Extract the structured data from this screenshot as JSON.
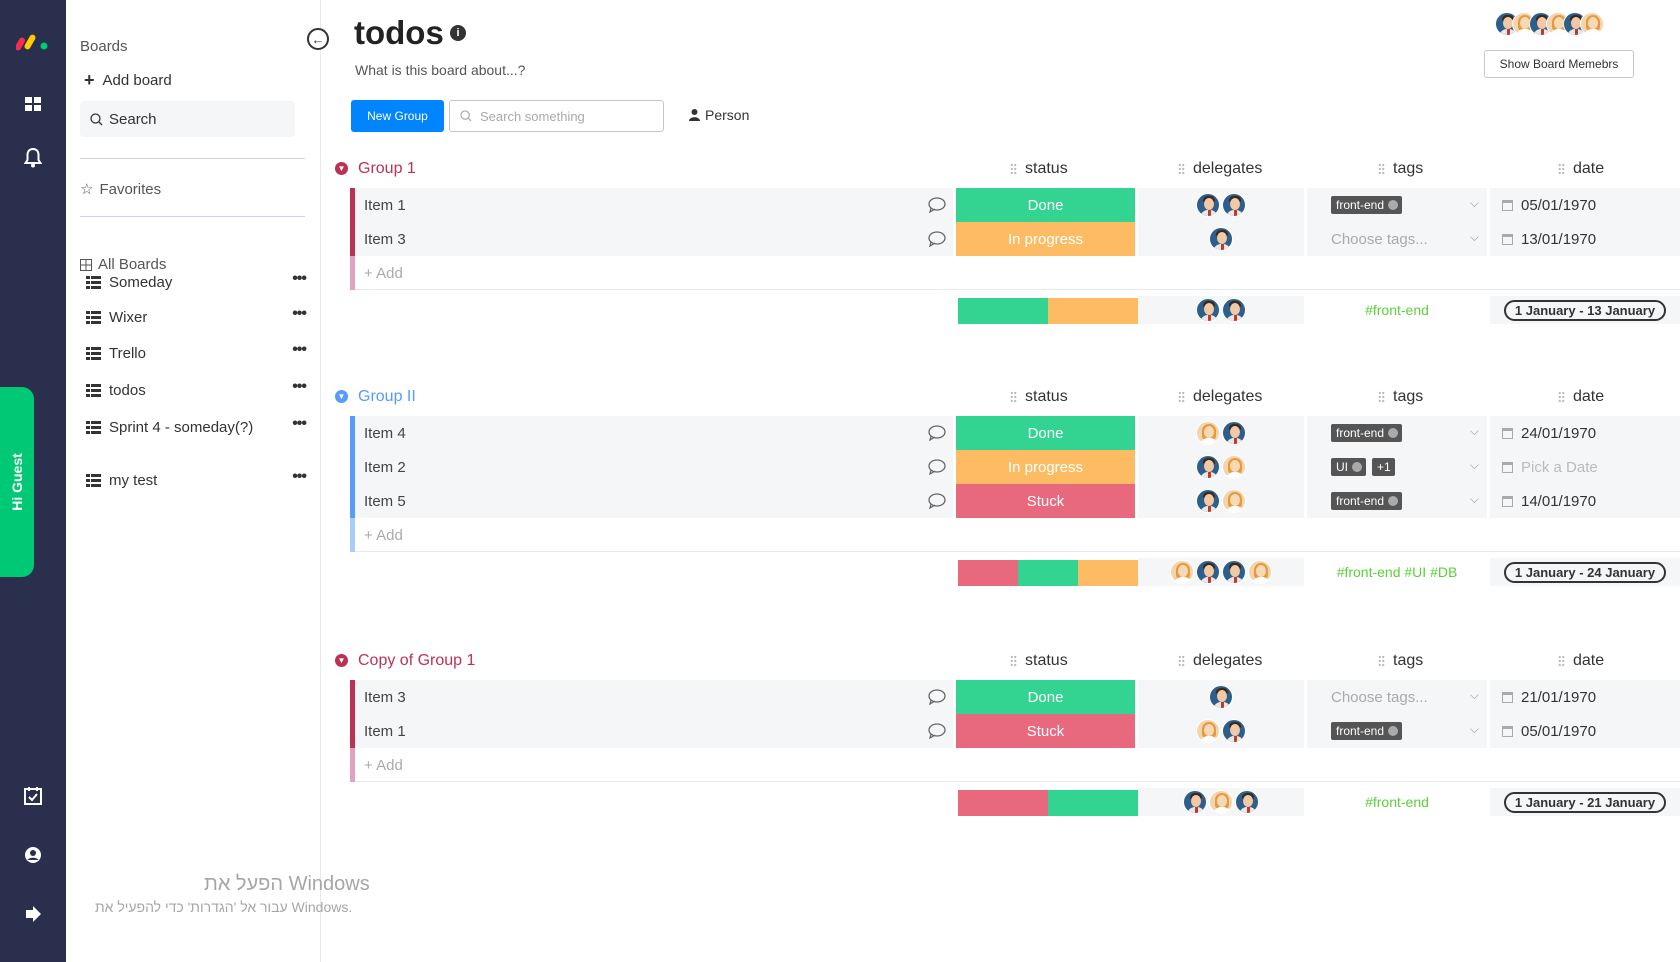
{
  "sidebar": {
    "title": "Boards",
    "add_board": "Add board",
    "search": "Search",
    "favorites": "Favorites",
    "all_boards": "All Boards",
    "boards": [
      "Someday",
      "Wixer",
      "Trello",
      "todos",
      "Sprint 4 - someday(?)",
      "my test"
    ],
    "guest_label": "Hi Guest"
  },
  "header": {
    "title": "todos",
    "description": "What is this board about...?",
    "show_members": "Show Board Memebrs",
    "new_group": "New Group",
    "search_placeholder": "Search something",
    "person_filter": "Person"
  },
  "columns": {
    "status": "status",
    "delegates": "delegates",
    "tags": "tags",
    "date": "date"
  },
  "colors": {
    "done": "#33d391",
    "in_progress": "#fdbc64",
    "stuck": "#e8697d",
    "group_purple": "#a25ddc",
    "group_magenta": "#bb3354",
    "group_blue": "#4eccc6",
    "accent_blue": "#0085ff",
    "rail": "#292f4c",
    "guest_green": "#00c875"
  },
  "groups": [
    {
      "name": "Group 1",
      "rows": [
        {
          "item": "Item 1",
          "status": "Done",
          "tags": [
            "front-end"
          ],
          "date": "05/01/1970"
        },
        {
          "item": "Item 3",
          "status": "In progress",
          "tags_placeholder": "Choose tags...",
          "date": "13/01/1970"
        }
      ],
      "add_label": "+ Add",
      "summary_tags": "#front-end",
      "summary_date": "1 January - 13 January"
    },
    {
      "name": "Group II",
      "rows": [
        {
          "item": "Item 4",
          "status": "Done",
          "tags": [
            "front-end"
          ],
          "date": "24/01/1970"
        },
        {
          "item": "Item 2",
          "status": "In progress",
          "tags": [
            "UI",
            "+1"
          ],
          "date_placeholder": "Pick a Date"
        },
        {
          "item": "Item 5",
          "status": "Stuck",
          "tags": [
            "front-end"
          ],
          "date": "14/01/1970"
        }
      ],
      "add_label": "+ Add",
      "summary_tags": "#front-end #UI #DB",
      "summary_date": "1 January - 24 January"
    },
    {
      "name": "Copy of Group 1",
      "rows": [
        {
          "item": "Item 3",
          "status": "Done",
          "tags_placeholder": "Choose tags...",
          "date": "21/01/1970"
        },
        {
          "item": "Item 1",
          "status": "Stuck",
          "tags": [
            "front-end"
          ],
          "date": "05/01/1970"
        }
      ],
      "add_label": "+ Add",
      "summary_tags": "#front-end",
      "summary_date": "1 January - 21 January"
    }
  ],
  "watermark": {
    "line1": "הפעל את Windows",
    "line2": "עבור אל 'הגדרות' כדי להפעיל את Windows."
  }
}
